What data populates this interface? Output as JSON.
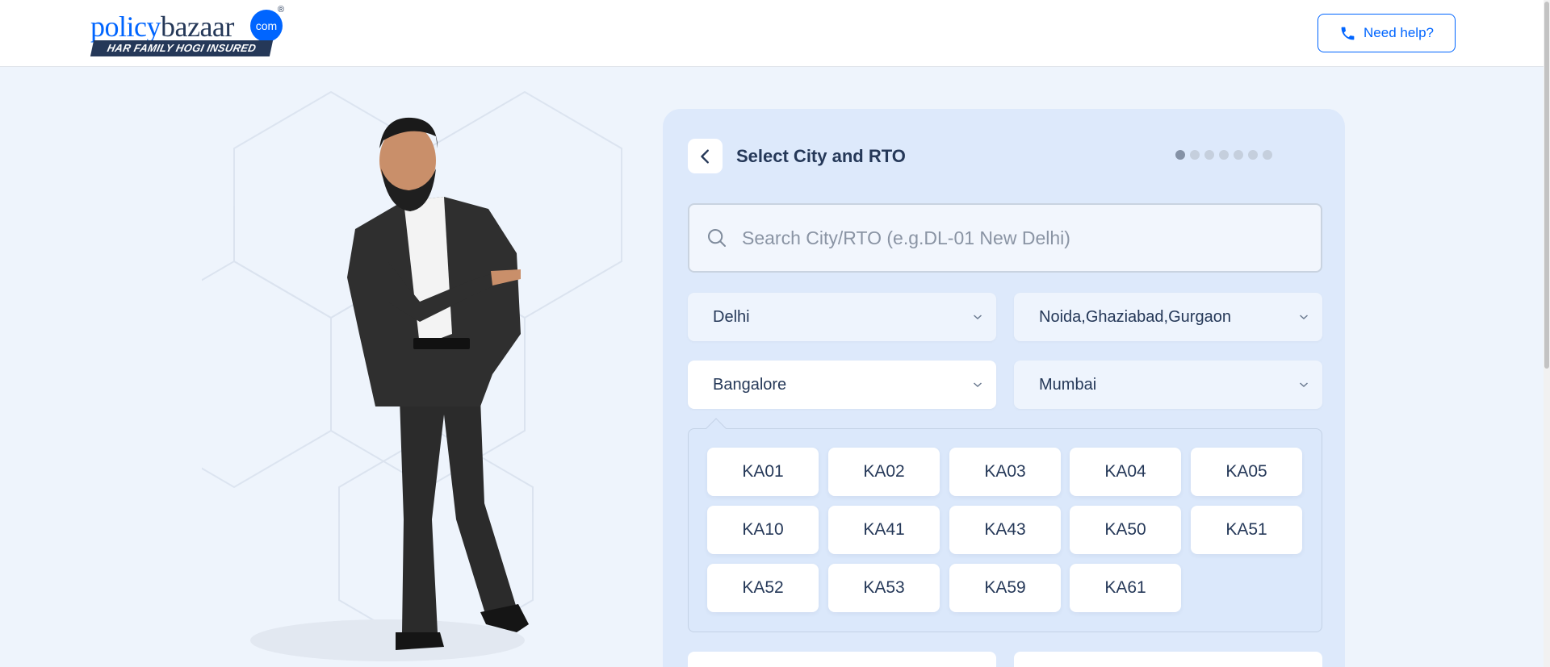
{
  "header": {
    "logo": {
      "word_part1": "policy",
      "word_part2": "bazaar",
      "dot_text": "com",
      "registered": "®",
      "tagline": "HAR FAMILY HOGI INSURED"
    },
    "help_button_label": "Need help?",
    "help_icon": "phone-icon"
  },
  "colors": {
    "brand_blue": "#0065ff",
    "navy": "#253858",
    "card_bg": "#dde9fb",
    "page_bg": "#eef4fc"
  },
  "card": {
    "back_icon": "chevron-left-icon",
    "title": "Select City and RTO",
    "progress": {
      "total_steps": 7,
      "current_step": 1
    },
    "search": {
      "icon": "search-icon",
      "placeholder": "Search City/RTO (e.g.DL-01 New Delhi)",
      "value": ""
    },
    "cities": [
      {
        "label": "Delhi",
        "selected": false
      },
      {
        "label": "Noida,Ghaziabad,Gurgaon",
        "selected": false
      },
      {
        "label": "Bangalore",
        "selected": true
      },
      {
        "label": "Mumbai",
        "selected": false
      }
    ],
    "rto_codes": [
      "KA01",
      "KA02",
      "KA03",
      "KA04",
      "KA05",
      "KA10",
      "KA41",
      "KA43",
      "KA50",
      "KA51",
      "KA52",
      "KA53",
      "KA59",
      "KA61"
    ]
  }
}
